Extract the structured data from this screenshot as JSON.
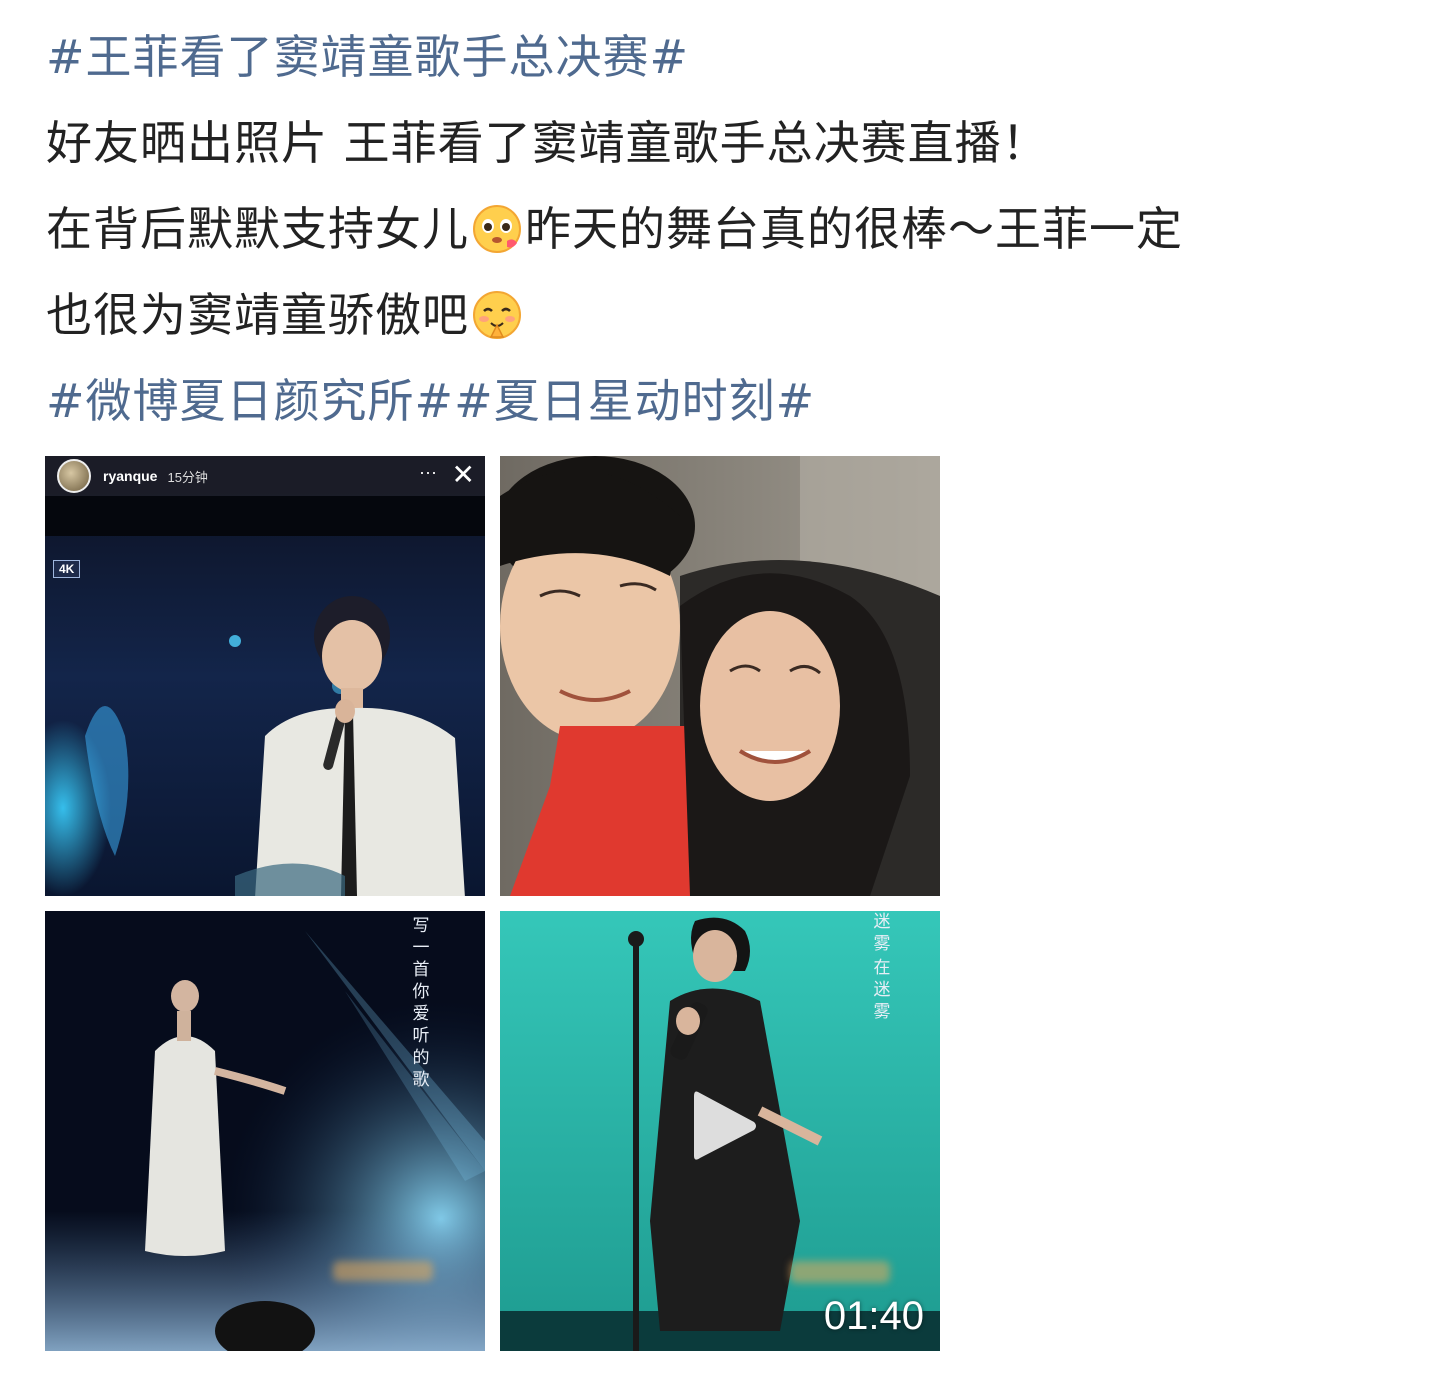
{
  "post": {
    "hashtag_top": "#王菲看了窦靖童歌手总决赛#",
    "line1": "好友晒出照片 王菲看了窦靖童歌手总决赛直播！",
    "line2_a": "在背后默默支持女儿",
    "line2_b": "昨天的舞台真的很棒～王菲一定",
    "line3": "也很为窦靖童骄傲吧",
    "hashtag_bottom_1": "#微博夏日颜究所#",
    "hashtag_bottom_2": "#夏日星动时刻#"
  },
  "colors": {
    "hashtag": "#4f6a8f",
    "text": "#222222"
  },
  "images": [
    {
      "type": "story-screenshot",
      "username": "ryanque",
      "time": "15分钟",
      "more": "···",
      "close": "✕",
      "badge": "4K"
    },
    {
      "type": "selfie-photo"
    },
    {
      "type": "stage-photo",
      "lyrics": "写一首你爱听的歌"
    },
    {
      "type": "video",
      "lyrics_1": "迷雾",
      "lyrics_2": "在迷雾",
      "duration": "01:40"
    }
  ],
  "icons": {
    "emoji_1": "pleading-face-icon",
    "emoji_2": "blush-praying-face-icon",
    "play": "play-icon"
  }
}
